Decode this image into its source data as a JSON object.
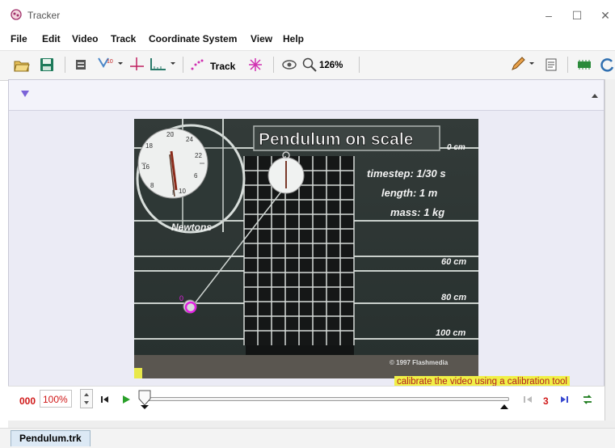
{
  "window": {
    "title": "Tracker",
    "controls": [
      "–",
      "☐",
      "✕"
    ]
  },
  "menu": [
    "File",
    "Edit",
    "Video",
    "Track",
    "Coordinate System",
    "View",
    "Help"
  ],
  "toolbar": {
    "track_label": "Track",
    "zoom": "126%"
  },
  "video": {
    "title": "Pendulum on scale",
    "timestep": "timestep: 1/30 s",
    "length": "length: 1 m",
    "mass": "mass: 1 kg",
    "scale_labels": [
      "0 cm",
      "60 cm",
      "80 cm",
      "100 cm"
    ],
    "scale_name": "Newtons",
    "copyright": "© 1997 Flashmedia",
    "marker_label": "0"
  },
  "player": {
    "frame": "000",
    "rate": "100%",
    "step_size": "3"
  },
  "hint": "calibrate the video using a calibration tool",
  "tabs": [
    {
      "label": "Pendulum.trk"
    }
  ],
  "colors": {
    "accent_red": "#d01818",
    "marker_magenta": "#e020e0",
    "hint_bg": "#f0f046"
  }
}
